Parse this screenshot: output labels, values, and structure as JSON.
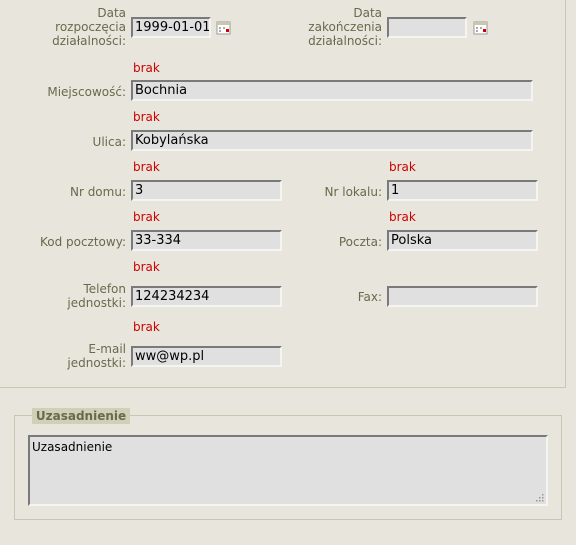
{
  "form": {
    "start_date": {
      "label_lines": [
        "Data",
        "rozpoczęcia",
        "działalności:"
      ],
      "value": "1999-01-01"
    },
    "end_date": {
      "label_lines": [
        "Data",
        "zakończenia",
        "działalności:"
      ],
      "value": ""
    },
    "city": {
      "label": "Miejscowość:",
      "value": "Bochnia",
      "error": "brak"
    },
    "street": {
      "label": "Ulica:",
      "value": "Kobylańska",
      "error": "brak"
    },
    "house_no": {
      "label": "Nr domu:",
      "value": "3",
      "error": "brak"
    },
    "flat_no": {
      "label": "Nr lokalu:",
      "value": "1",
      "error": "brak"
    },
    "postal_code": {
      "label": "Kod pocztowy:",
      "value": "33-334",
      "error": "brak"
    },
    "post_office": {
      "label": "Poczta:",
      "value": "Polska",
      "error": "brak"
    },
    "phone": {
      "label_lines": [
        "Telefon",
        "jednostki:"
      ],
      "value": "124234234",
      "error": "brak"
    },
    "fax": {
      "label": "Fax:",
      "value": ""
    },
    "email": {
      "label_lines": [
        "E-mail",
        "jednostki:"
      ],
      "value": "ww@wp.pl",
      "error": "brak"
    }
  },
  "justification": {
    "legend": "Uzasadnienie",
    "value": "Uzasadnienie"
  },
  "icons": {
    "calendar": "calendar-icon",
    "resize": "resize-grip-icon"
  }
}
